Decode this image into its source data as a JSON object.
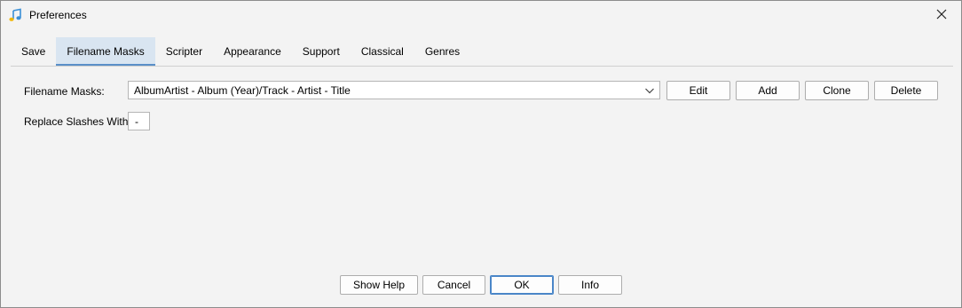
{
  "window": {
    "title": "Preferences",
    "app_icon": "music-note-icon",
    "close_icon": "close-icon"
  },
  "tabs": [
    {
      "label": "Save",
      "active": false
    },
    {
      "label": "Filename Masks",
      "active": true
    },
    {
      "label": "Scripter",
      "active": false
    },
    {
      "label": "Appearance",
      "active": false
    },
    {
      "label": "Support",
      "active": false
    },
    {
      "label": "Classical",
      "active": false
    },
    {
      "label": "Genres",
      "active": false
    }
  ],
  "masks": {
    "label": "Filename Masks:",
    "selected": "AlbumArtist - Album (Year)/Track - Artist - Title",
    "buttons": {
      "edit": "Edit",
      "add": "Add",
      "clone": "Clone",
      "delete": "Delete"
    }
  },
  "slashes": {
    "label": "Replace Slashes With",
    "value": "-"
  },
  "footer": {
    "show_help": "Show Help",
    "cancel": "Cancel",
    "ok": "OK",
    "info": "Info"
  },
  "colors": {
    "active_tab_bg": "#d9e5f1",
    "active_tab_underline": "#5a8fc8",
    "default_button_border": "#4a86c8"
  }
}
